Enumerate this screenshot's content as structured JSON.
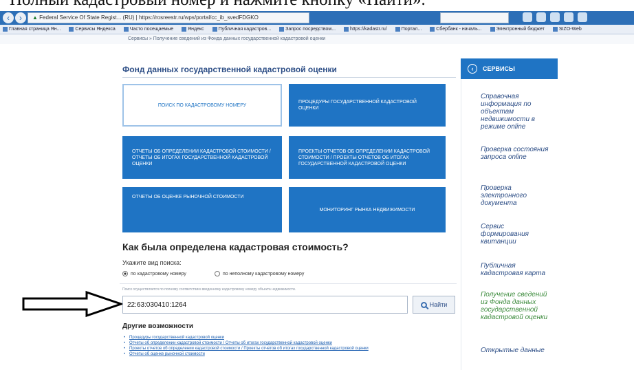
{
  "caption": "Полный кадастровый номер и нажмите кнопку «Найти».",
  "browser": {
    "url_tab": "Federal Service Of State Regist... (RU) | https://rosreestr.ru/wps/portal/cc_ib_svedFDGKO",
    "bookmarks": [
      "Главная страница Ян...",
      "Сервисы Яндекса",
      "Часто посещаемые",
      "Яндекс",
      "Публичная кадастров...",
      "Запрос посредством...",
      "https://kadastr.ru/",
      "Портал...",
      "Сбербанк - началь...",
      "Электронный бюджет",
      "SIZO-Web"
    ],
    "breadcrumb": "Сервисы  »  Получение сведений из Фонда данных государственной кадастровой оценки"
  },
  "page": {
    "title": "Фонд данных государственной кадастровой оценки",
    "tiles": [
      "ПОИСК ПО КАДАСТРОВОМУ НОМЕРУ",
      "ПРОЦЕДУРЫ ГОСУДАРСТВЕННОЙ КАДАСТРОВОЙ ОЦЕНКИ",
      "ОТЧЕТЫ ОБ ОПРЕДЕЛЕНИИ КАДАСТРОВОЙ СТОИМОСТИ / ОТЧЕТЫ ОБ ИТОГАХ ГОСУДАРСТВЕННОЙ КАДАСТРОВОЙ ОЦЕНКИ",
      "ПРОЕКТЫ ОТЧЕТОВ ОБ ОПРЕДЕЛЕНИИ КАДАСТРОВОЙ СТОИМОСТИ / ПРОЕКТЫ ОТЧЕТОВ ОБ ИТОГАХ ГОСУДАРСТВЕННОЙ КАДАСТРОВОЙ ОЦЕНКИ",
      "ОТЧЕТЫ ОБ ОЦЕНКЕ РЫНОЧНОЙ СТОИМОСТИ",
      "МОНИТОРИНГ РЫНКА НЕДВИЖИМОСТИ"
    ],
    "section_title": "Как была определена кадастровая стоимость?",
    "search_type_label": "Укажите вид поиска:",
    "radio_full": "по кадастровому номеру",
    "radio_partial": "по неполному кадастровому номеру",
    "hint": "Поиск осуществляется по полному соответствию введенному кадастровому номеру объекта недвижимости.",
    "search_value": "22:63:030410:1264",
    "find_label": "Найти",
    "other_title": "Другие возможности",
    "other_links": [
      "Процедуры государственной кадастровой оценки",
      "Отчеты об определении кадастровой стоимости / Отчеты об итогах государственной кадастровой оценки",
      "Проекты отчетов об определении кадастровой стоимости / Проекты отчетов об итогах государственной кадастровой оценки",
      "Отчеты об оценке рыночной стоимости"
    ]
  },
  "services": {
    "head": "СЕРВИСЫ",
    "items": [
      "Справочная информация по объектам недвижимости в режиме online",
      "Проверка состояния запроса online",
      "Проверка электронного документа",
      "Сервис формирования квитанции",
      "Публичная кадастровая карта",
      "Получение сведений из Фонда данных государственной кадастровой оценки",
      "Открытые данные"
    ]
  },
  "colors": {
    "accent": "#1f74c4",
    "title": "#2d4e86",
    "active_service": "#3c8b3c"
  }
}
